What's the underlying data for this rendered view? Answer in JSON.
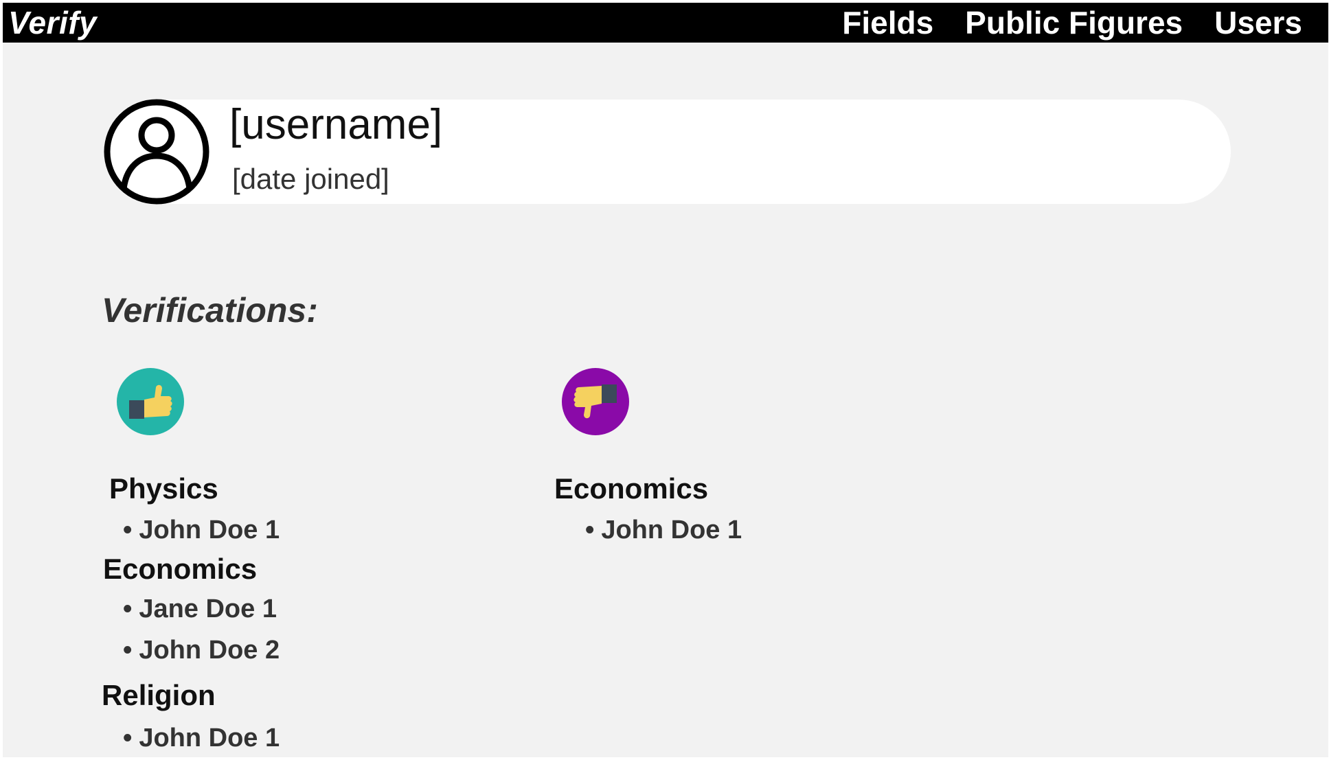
{
  "nav": {
    "brand": "Verify",
    "links": [
      "Fields",
      "Public Figures",
      "Users"
    ]
  },
  "profile": {
    "username": "[username]",
    "date_joined": "[date joined]",
    "avatar_icon": "user-avatar-icon"
  },
  "verifications": {
    "title": "Verifications:",
    "positive": {
      "icon": "thumbs-up-icon",
      "color": "#24b5a8",
      "groups": [
        {
          "field": "Physics",
          "people": [
            "John Doe 1"
          ]
        },
        {
          "field": "Economics",
          "people": [
            "Jane Doe 1",
            "John Doe 2"
          ]
        },
        {
          "field": "Religion",
          "people": [
            "John Doe 1"
          ]
        }
      ]
    },
    "negative": {
      "icon": "thumbs-down-icon",
      "color": "#8a0aa8",
      "groups": [
        {
          "field": "Economics",
          "people": [
            "John Doe 1"
          ]
        }
      ]
    }
  },
  "colors": {
    "navbar": "#000000",
    "background": "#f2f2f2",
    "card": "#ffffff",
    "thumb": "#f5d15f",
    "cuff": "#3b4a5a"
  }
}
